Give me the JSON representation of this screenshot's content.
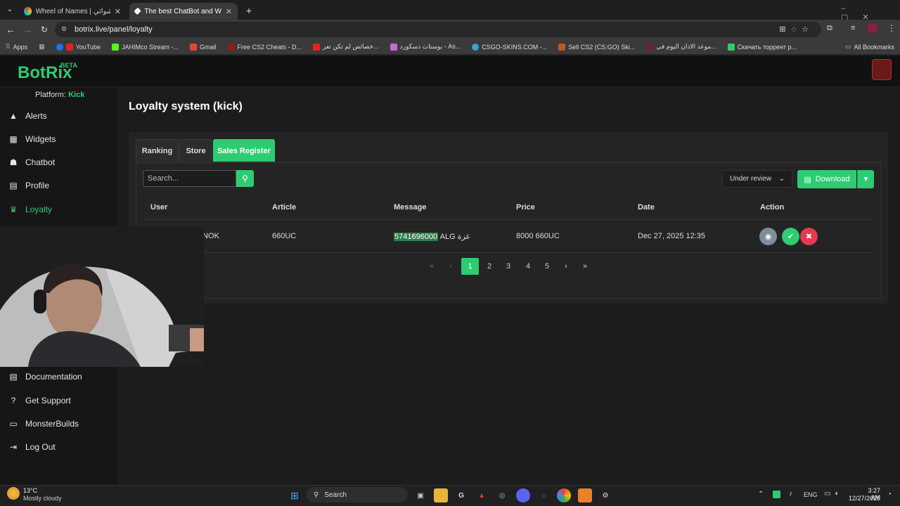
{
  "browser": {
    "tabs": [
      {
        "label": "Wheel of Names | ‏سم العشوائي",
        "active": false
      },
      {
        "label": "The best ChatBot and Widgets",
        "active": true
      }
    ],
    "new_tab": "+",
    "url": "botrix.live/panel/loyalty",
    "bookmarks": [
      {
        "label": "Apps",
        "icon": "apps-icon"
      },
      {
        "label": "YouTube",
        "icon": "youtube-icon"
      },
      {
        "label": "JAHIMco Stream -...",
        "icon": "kick-icon"
      },
      {
        "label": "Gmail",
        "icon": "gmail-icon"
      },
      {
        "label": "Free CS2 Cheats - D...",
        "icon": "site-icon"
      },
      {
        "label": "خصائص لم تكن تعر...",
        "icon": "youtube-icon"
      },
      {
        "label": "بوستات دسكورد - As...",
        "icon": "gem-icon"
      },
      {
        "label": "CSGO-SKINS.COM -...",
        "icon": "site-icon"
      },
      {
        "label": "Sell CS2 (CS:GO) Ski...",
        "icon": "site-icon"
      },
      {
        "label": "موعد الاذان اليوم في...",
        "icon": "site-icon"
      },
      {
        "label": "Скачать торрент р...",
        "icon": "torrent-icon"
      }
    ],
    "all_bookmarks": "All Bookmarks"
  },
  "app": {
    "logo": "BotRix",
    "beta": "BETA",
    "platform_label": "Platform:",
    "platform_value": "Kick",
    "nav": [
      {
        "label": "Alerts",
        "icon": "warning-icon",
        "active": false
      },
      {
        "label": "Widgets",
        "icon": "widgets-icon",
        "active": false
      },
      {
        "label": "Chatbot",
        "icon": "robot-icon",
        "active": false
      },
      {
        "label": "Profile",
        "icon": "id-card-icon",
        "active": false
      },
      {
        "label": "Loyalty",
        "icon": "trophy-icon",
        "active": true
      }
    ],
    "nav_bottom": [
      {
        "label": "Documentation",
        "icon": "scroll-icon"
      },
      {
        "label": "Get Support",
        "icon": "question-icon"
      },
      {
        "label": "MonsterBuilds",
        "icon": "laptop-icon"
      },
      {
        "label": "Log Out",
        "icon": "logout-icon"
      }
    ],
    "page_title": "Loyalty system (kick)",
    "tabs": [
      {
        "label": "Ranking",
        "active": false
      },
      {
        "label": "Store",
        "active": false
      },
      {
        "label": "Sales Register",
        "active": true
      }
    ],
    "search_placeholder": "Search...",
    "status_filter": "Under review",
    "download_label": "Download",
    "table": {
      "headers": [
        "User",
        "Article",
        "Message",
        "Price",
        "Date",
        "Action"
      ],
      "rows": [
        {
          "user": "NOK",
          "article": "660UC",
          "message_highlight": "5741696000",
          "message_rest": " ALG غزة",
          "price": "8000 660UC",
          "date": "Dec 27, 2025 12:35"
        }
      ]
    },
    "pagination": {
      "first": "«",
      "prev": "‹",
      "pages": [
        "1",
        "2",
        "3",
        "4",
        "5"
      ],
      "current": "1",
      "next": "›",
      "last": "»"
    }
  },
  "taskbar": {
    "weather_temp": "13°C",
    "weather_desc": "Mostly cloudy",
    "search_label": "Search",
    "lang": "ENG",
    "time": "3:27 AM",
    "date": "12/27/2025"
  },
  "colors": {
    "accent": "#2ecc71",
    "danger": "#e53950",
    "view": "#7f8c9a"
  }
}
